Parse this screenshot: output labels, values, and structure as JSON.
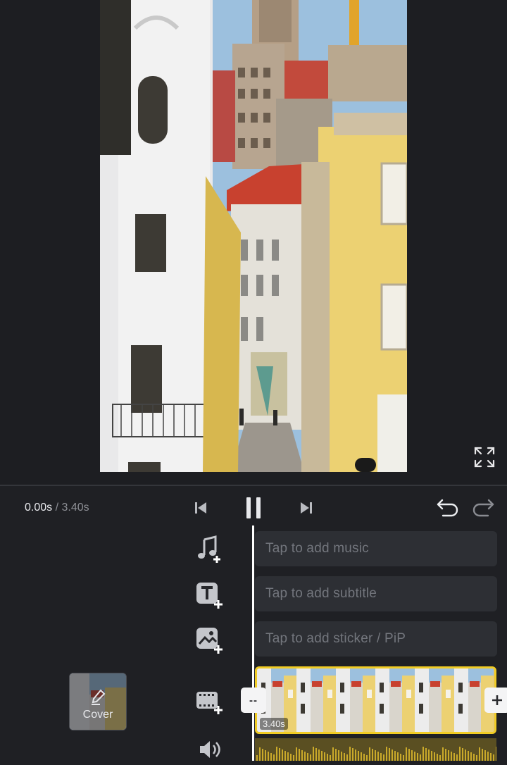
{
  "player": {
    "current_time": "0.00s",
    "separator": " / ",
    "total_time": "3.40s"
  },
  "tracks": {
    "music_placeholder": "Tap to add music",
    "subtitle_placeholder": "Tap to add subtitle",
    "sticker_placeholder": "Tap to add sticker / PiP"
  },
  "clip": {
    "duration": "3.40s",
    "trim_label": "--"
  },
  "cover": {
    "label": "Cover"
  },
  "icons": {
    "fullscreen": "expand-arrows-icon",
    "prev": "skip-back-icon",
    "pause": "pause-icon",
    "next": "skip-forward-icon",
    "undo": "undo-icon",
    "redo": "redo-icon",
    "music": "music-note-plus-icon",
    "text": "text-plus-icon",
    "sticker": "image-plus-icon",
    "video": "film-plus-icon",
    "audio": "speaker-icon"
  },
  "colors": {
    "background": "#1f2024",
    "clip_border": "#f1cc25",
    "slot": "#2d2f34",
    "slot_text": "#73767d",
    "playhead": "#ffffff"
  }
}
